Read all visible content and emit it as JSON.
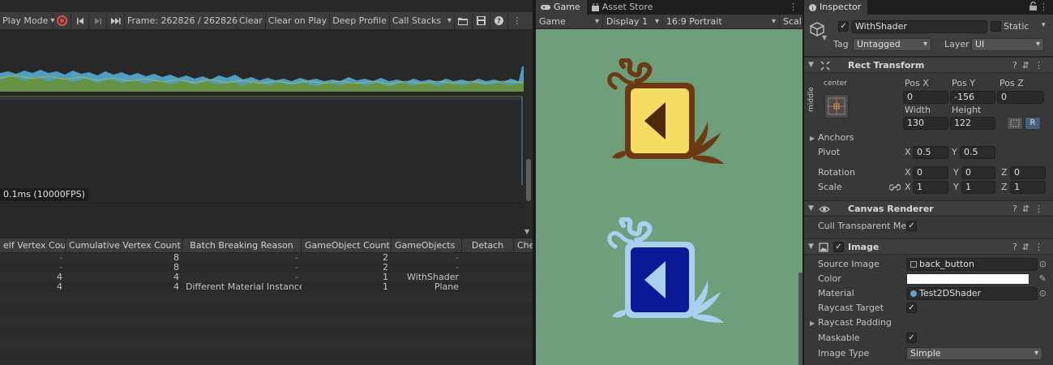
{
  "profiler": {
    "toolbar": {
      "play_mode": "Play Mode",
      "frame": "Frame: 262826 / 262826",
      "clear": "Clear",
      "clear_on_play": "Clear on Play",
      "deep_profile": "Deep Profile",
      "call_stacks": "Call Stacks"
    },
    "tooltip": "0.1ms (10000FPS)",
    "table": {
      "headers": [
        "elf Vertex Cour",
        "Cumulative Vertex Count",
        "Batch Breaking Reason",
        "GameObject Count",
        "GameObjects",
        "Detach",
        "Che"
      ],
      "rows": [
        [
          "-",
          "8",
          "-",
          "2",
          "-"
        ],
        [
          "-",
          "8",
          "-",
          "2",
          "-"
        ],
        [
          "4",
          "4",
          "-",
          "1",
          "WithShader"
        ],
        [
          "4",
          "4",
          "Different Material Instance",
          "1",
          "Plane"
        ]
      ]
    }
  },
  "game": {
    "tabs": [
      "Game",
      "Asset Store"
    ],
    "toolbar": {
      "view": "Game",
      "display": "Display 1",
      "aspect": "16:9 Portrait",
      "scale": "Scal"
    },
    "background": "#6e9f7a"
  },
  "inspector": {
    "tab": "Inspector",
    "object_name": "WithShader",
    "static_label": "Static",
    "tag_label": "Tag",
    "tag_value": "Untagged",
    "layer_label": "Layer",
    "layer_value": "UI",
    "rect_transform": {
      "title": "Rect Transform",
      "anchor_h": "center",
      "anchor_v": "middle",
      "posx_label": "Pos X",
      "posy_label": "Pos Y",
      "posz_label": "Pos Z",
      "posx": "0",
      "posy": "-156",
      "posz": "0",
      "width_label": "Width",
      "height_label": "Height",
      "width": "130",
      "height": "122",
      "anchors_label": "Anchors",
      "pivot_label": "Pivot",
      "pivot_x": "0.5",
      "pivot_y": "0.5",
      "rotation_label": "Rotation",
      "rot_x": "0",
      "rot_y": "0",
      "rot_z": "0",
      "scale_label": "Scale",
      "scale_x": "1",
      "scale_y": "1",
      "scale_z": "1",
      "x": "X",
      "y": "Y",
      "z": "Z",
      "r_button": "R"
    },
    "canvas_renderer": {
      "title": "Canvas Renderer",
      "cull_label": "Cull Transparent Me"
    },
    "image": {
      "title": "Image",
      "source_label": "Source Image",
      "source_value": "back_button",
      "color_label": "Color",
      "material_label": "Material",
      "material_value": "Test2DShader",
      "raycast_label": "Raycast Target",
      "raycast_padding_label": "Raycast Padding",
      "maskable_label": "Maskable",
      "image_type_label": "Image Type",
      "image_type_value": "Simple"
    }
  }
}
